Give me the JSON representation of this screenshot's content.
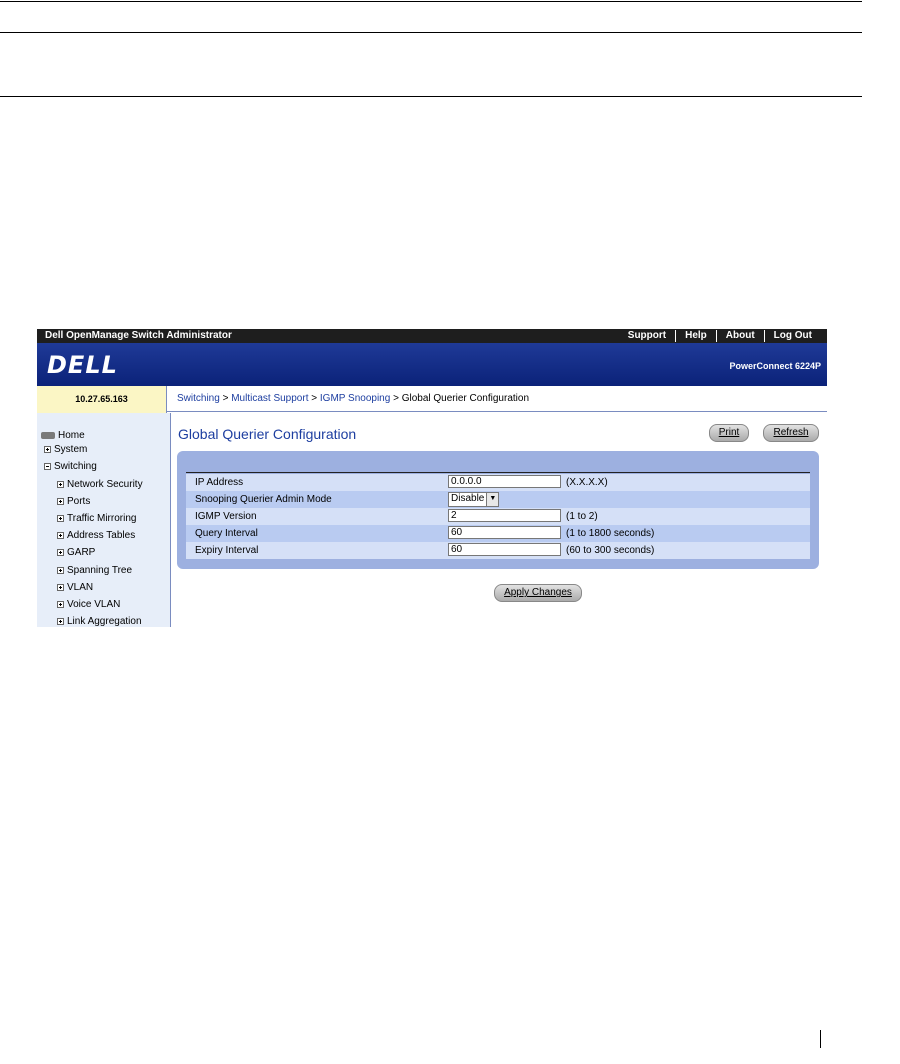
{
  "app": {
    "title": "Dell OpenManage Switch Administrator",
    "top_links": [
      "Support",
      "Help",
      "About",
      "Log Out"
    ],
    "logo": "DELL",
    "model": "PowerConnect 6224P",
    "ip": "10.27.65.163"
  },
  "breadcrumb": {
    "items": [
      "Switching",
      "Multicast Support",
      "IGMP Snooping"
    ],
    "current": "Global Querier Configuration",
    "sep": ">"
  },
  "nav": {
    "items": [
      {
        "label": "Home",
        "icon": "home-icon"
      },
      {
        "label": "System",
        "icon": "expand-icon"
      },
      {
        "label": "Switching",
        "icon": "collapse-icon"
      },
      {
        "label": "Network Security",
        "icon": "expand-icon"
      },
      {
        "label": "Ports",
        "icon": "expand-icon"
      },
      {
        "label": "Traffic Mirroring",
        "icon": "expand-icon"
      },
      {
        "label": "Address Tables",
        "icon": "expand-icon"
      },
      {
        "label": "GARP",
        "icon": "expand-icon"
      },
      {
        "label": "Spanning Tree",
        "icon": "expand-icon"
      },
      {
        "label": "VLAN",
        "icon": "expand-icon"
      },
      {
        "label": "Voice VLAN",
        "icon": "expand-icon"
      },
      {
        "label": "Link Aggregation",
        "icon": "expand-icon"
      }
    ]
  },
  "page": {
    "title": "Global Querier Configuration",
    "print_label": "Print",
    "refresh_label": "Refresh",
    "apply_label": "Apply Changes"
  },
  "form": {
    "ip_address": {
      "label": "IP Address",
      "value": "0.0.0.0",
      "hint": "(X.X.X.X)"
    },
    "admin_mode": {
      "label": "Snooping Querier Admin Mode",
      "value": "Disable"
    },
    "igmp_version": {
      "label": "IGMP Version",
      "value": "2",
      "hint": "(1 to 2)"
    },
    "query_interval": {
      "label": "Query Interval",
      "value": "60",
      "hint": "(1 to 1800 seconds)"
    },
    "expiry_interval": {
      "label": "Expiry Interval",
      "value": "60",
      "hint": "(60 to 300 seconds)"
    }
  },
  "colors": {
    "banner": "#0b2279",
    "nav_bg": "#e7eef9",
    "panel": "#9db0e0",
    "link": "#1d3ea0"
  }
}
